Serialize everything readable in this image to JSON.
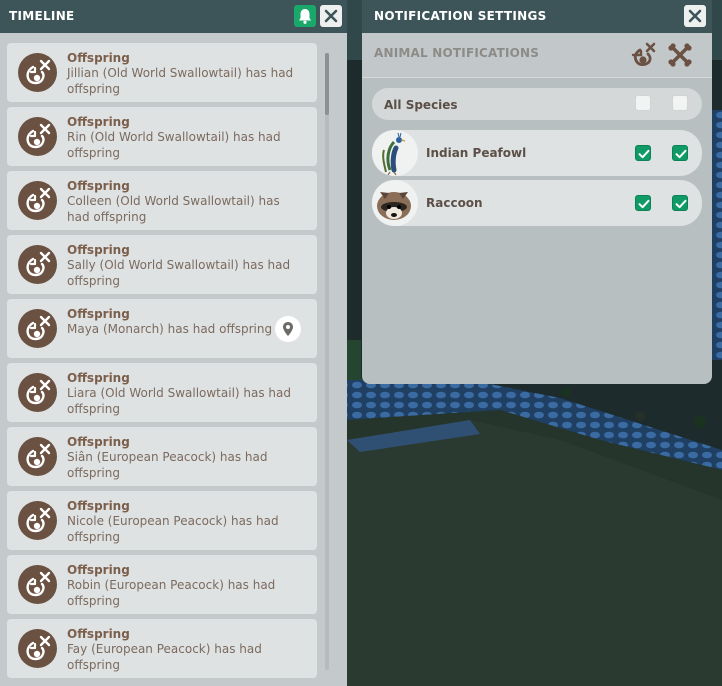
{
  "timeline": {
    "title": "TIMELINE",
    "bell_icon": "bell-icon",
    "close_icon": "close-icon",
    "entries": [
      {
        "title": "Offspring",
        "text": "Jillian (Old World Swallowtail) has had offspring",
        "pin": false
      },
      {
        "title": "Offspring",
        "text": "Rin (Old World Swallowtail) has had offspring",
        "pin": false
      },
      {
        "title": "Offspring",
        "text": "Colleen (Old World Swallowtail) has had offspring",
        "pin": false
      },
      {
        "title": "Offspring",
        "text": "Sally (Old World Swallowtail) has had offspring",
        "pin": false
      },
      {
        "title": "Offspring",
        "text": "Maya (Monarch) has had offspring",
        "pin": true
      },
      {
        "title": "Offspring",
        "text": "Liara (Old World Swallowtail) has had offspring",
        "pin": false
      },
      {
        "title": "Offspring",
        "text": "Siân (European Peacock) has had offspring",
        "pin": false
      },
      {
        "title": "Offspring",
        "text": "Nicole (European Peacock) has had offspring",
        "pin": false
      },
      {
        "title": "Offspring",
        "text": "Robin (European Peacock) has had offspring",
        "pin": false
      },
      {
        "title": "Offspring",
        "text": "Fay (European Peacock) has had offspring",
        "pin": false
      }
    ]
  },
  "notification_settings": {
    "title": "NOTIFICATION SETTINGS",
    "close_icon": "close-icon",
    "section_label": "ANIMAL NOTIFICATIONS",
    "column_icons": [
      "offspring-icon",
      "bones-icon"
    ],
    "all_species": {
      "label": "All Species",
      "offspring": false,
      "death": false
    },
    "species": [
      {
        "name": "Indian Peafowl",
        "avatar": "peafowl-avatar",
        "offspring": true,
        "death": true
      },
      {
        "name": "Raccoon",
        "avatar": "raccoon-avatar",
        "offspring": true,
        "death": true
      }
    ]
  },
  "colors": {
    "header": "#3d5558",
    "accent_green": "#1aa76a",
    "checkbox_on": "#0f9a66",
    "icon_brown": "#6b5142"
  }
}
